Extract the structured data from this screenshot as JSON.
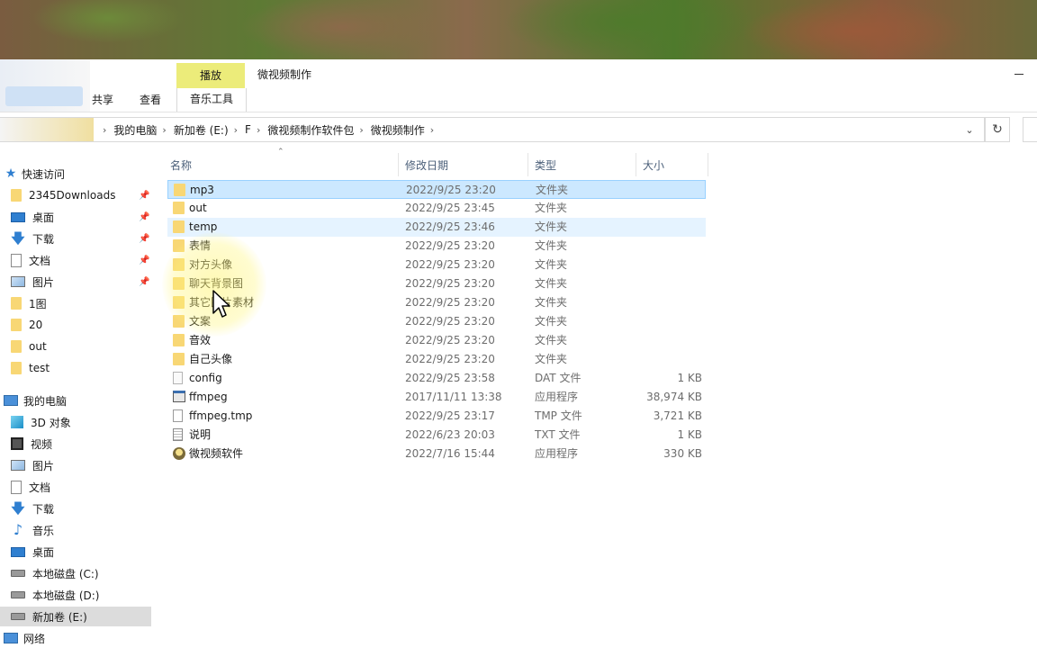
{
  "window": {
    "title": "微视频制作"
  },
  "ribbon": {
    "context_tab": "播放",
    "tabs": [
      {
        "label": "共享"
      },
      {
        "label": "查看"
      },
      {
        "label": "音乐工具"
      }
    ]
  },
  "breadcrumb": [
    "我的电脑",
    "新加卷 (E:)",
    "F",
    "微视频制作软件包",
    "微视频制作"
  ],
  "columns": {
    "name": "名称",
    "date": "修改日期",
    "type": "类型",
    "size": "大小"
  },
  "sidebar": {
    "quick_access": "快速访问",
    "quick_items": [
      {
        "label": "2345Downloads",
        "icon": "folder-icon",
        "pinned": true
      },
      {
        "label": "桌面",
        "icon": "desktop-icon",
        "pinned": true
      },
      {
        "label": "下载",
        "icon": "download-icon",
        "pinned": true
      },
      {
        "label": "文档",
        "icon": "document-icon",
        "pinned": true
      },
      {
        "label": "图片",
        "icon": "picture-icon",
        "pinned": true
      },
      {
        "label": "1图",
        "icon": "folder-icon",
        "pinned": false
      },
      {
        "label": "20",
        "icon": "folder-icon",
        "pinned": false
      },
      {
        "label": "out",
        "icon": "folder-icon",
        "pinned": false
      },
      {
        "label": "test",
        "icon": "folder-icon",
        "pinned": false
      }
    ],
    "this_pc": "我的电脑",
    "pc_items": [
      {
        "label": "3D 对象",
        "icon": "cube-icon"
      },
      {
        "label": "视频",
        "icon": "video-icon"
      },
      {
        "label": "图片",
        "icon": "picture-icon"
      },
      {
        "label": "文档",
        "icon": "document-icon"
      },
      {
        "label": "下载",
        "icon": "download-icon"
      },
      {
        "label": "音乐",
        "icon": "music-icon"
      },
      {
        "label": "桌面",
        "icon": "desktop-icon"
      },
      {
        "label": "本地磁盘 (C:)",
        "icon": "drive-icon"
      },
      {
        "label": "本地磁盘 (D:)",
        "icon": "drive-icon"
      },
      {
        "label": "新加卷 (E:)",
        "icon": "drive-icon",
        "selected": true
      }
    ],
    "network": "网络"
  },
  "files": [
    {
      "name": "mp3",
      "date": "2022/9/25 23:20",
      "type": "文件夹",
      "size": "",
      "icon": "folder-icon",
      "state": "selected"
    },
    {
      "name": "out",
      "date": "2022/9/25 23:45",
      "type": "文件夹",
      "size": "",
      "icon": "folder-icon"
    },
    {
      "name": "temp",
      "date": "2022/9/25 23:46",
      "type": "文件夹",
      "size": "",
      "icon": "folder-icon",
      "state": "hover"
    },
    {
      "name": "表情",
      "date": "2022/9/25 23:20",
      "type": "文件夹",
      "size": "",
      "icon": "folder-icon"
    },
    {
      "name": "对方头像",
      "date": "2022/9/25 23:20",
      "type": "文件夹",
      "size": "",
      "icon": "folder-icon"
    },
    {
      "name": "聊天背景图",
      "date": "2022/9/25 23:20",
      "type": "文件夹",
      "size": "",
      "icon": "folder-icon"
    },
    {
      "name": "其它图片素材",
      "date": "2022/9/25 23:20",
      "type": "文件夹",
      "size": "",
      "icon": "folder-icon"
    },
    {
      "name": "文案",
      "date": "2022/9/25 23:20",
      "type": "文件夹",
      "size": "",
      "icon": "folder-icon"
    },
    {
      "name": "音效",
      "date": "2022/9/25 23:20",
      "type": "文件夹",
      "size": "",
      "icon": "folder-icon"
    },
    {
      "name": "自己头像",
      "date": "2022/9/25 23:20",
      "type": "文件夹",
      "size": "",
      "icon": "folder-icon"
    },
    {
      "name": "config",
      "date": "2022/9/25 23:58",
      "type": "DAT 文件",
      "size": "1 KB",
      "icon": "dat-file-icon"
    },
    {
      "name": "ffmpeg",
      "date": "2017/11/11 13:38",
      "type": "应用程序",
      "size": "38,974 KB",
      "icon": "exe-icon"
    },
    {
      "name": "ffmpeg.tmp",
      "date": "2022/9/25 23:17",
      "type": "TMP 文件",
      "size": "3,721 KB",
      "icon": "tmp-file-icon"
    },
    {
      "name": "说明",
      "date": "2022/6/23 20:03",
      "type": "TXT 文件",
      "size": "1 KB",
      "icon": "txt-file-icon"
    },
    {
      "name": "微视频软件",
      "date": "2022/7/16 15:44",
      "type": "应用程序",
      "size": "330 KB",
      "icon": "app-icon"
    }
  ]
}
